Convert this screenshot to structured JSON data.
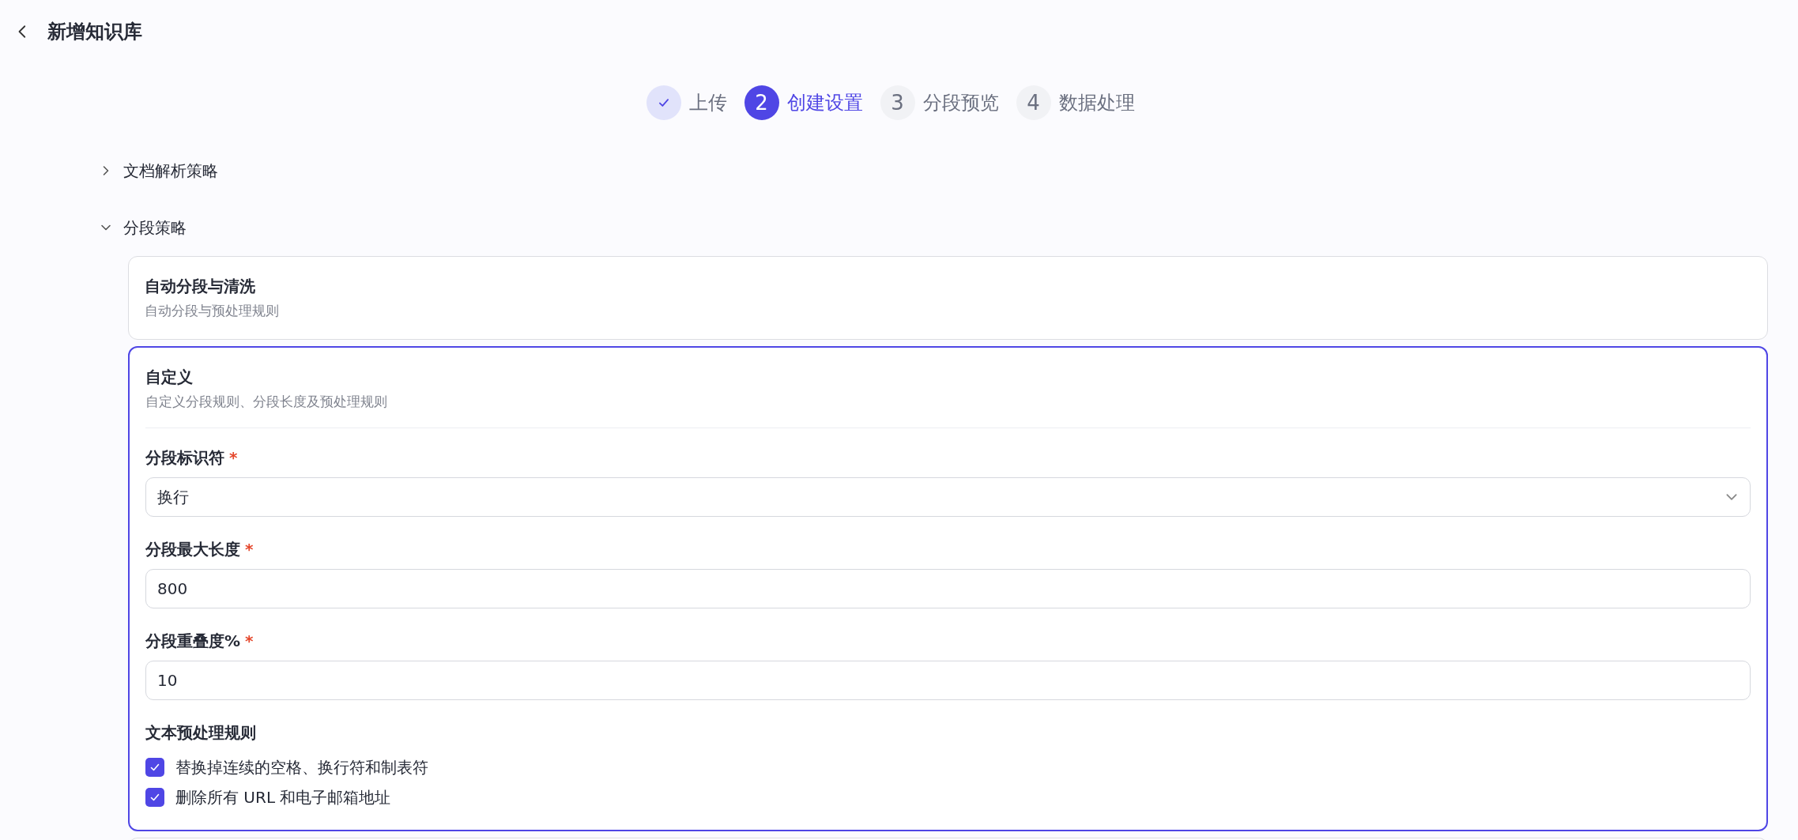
{
  "header": {
    "title": "新增知识库"
  },
  "steps": [
    {
      "label": "上传",
      "completed": true,
      "selected": false
    },
    {
      "number": "2",
      "label": "创建设置",
      "completed": false,
      "selected": true
    },
    {
      "number": "3",
      "label": "分段预览",
      "completed": false,
      "selected": false
    },
    {
      "number": "4",
      "label": "数据处理",
      "completed": false,
      "selected": false
    }
  ],
  "sections": [
    {
      "title": "文档解析策略",
      "expanded": false
    },
    {
      "title": "分段策略",
      "expanded": true,
      "options": [
        {
          "title": "自动分段与清洗",
          "description": "自动分段与预处理规则",
          "selected": false
        },
        {
          "title": "自定义",
          "description": "自定义分段规则、分段长度及预处理规则",
          "selected": true,
          "fields": [
            {
              "kind": "select",
              "label": "分段标识符",
              "required_mark": "*",
              "value": "换行"
            },
            {
              "kind": "input",
              "label": "分段最大长度",
              "required_mark": "*",
              "value": "800"
            },
            {
              "kind": "input",
              "label": "分段重叠度%",
              "required_mark": "*",
              "value": "10"
            }
          ],
          "rules_title": "文本预处理规则",
          "rules": [
            {
              "label": "替换掉连续的空格、换行符和制表符",
              "checked": true
            },
            {
              "label": "删除所有 URL 和电子邮箱地址",
              "checked": true
            }
          ]
        },
        {
          "selected": false
        }
      ]
    }
  ]
}
